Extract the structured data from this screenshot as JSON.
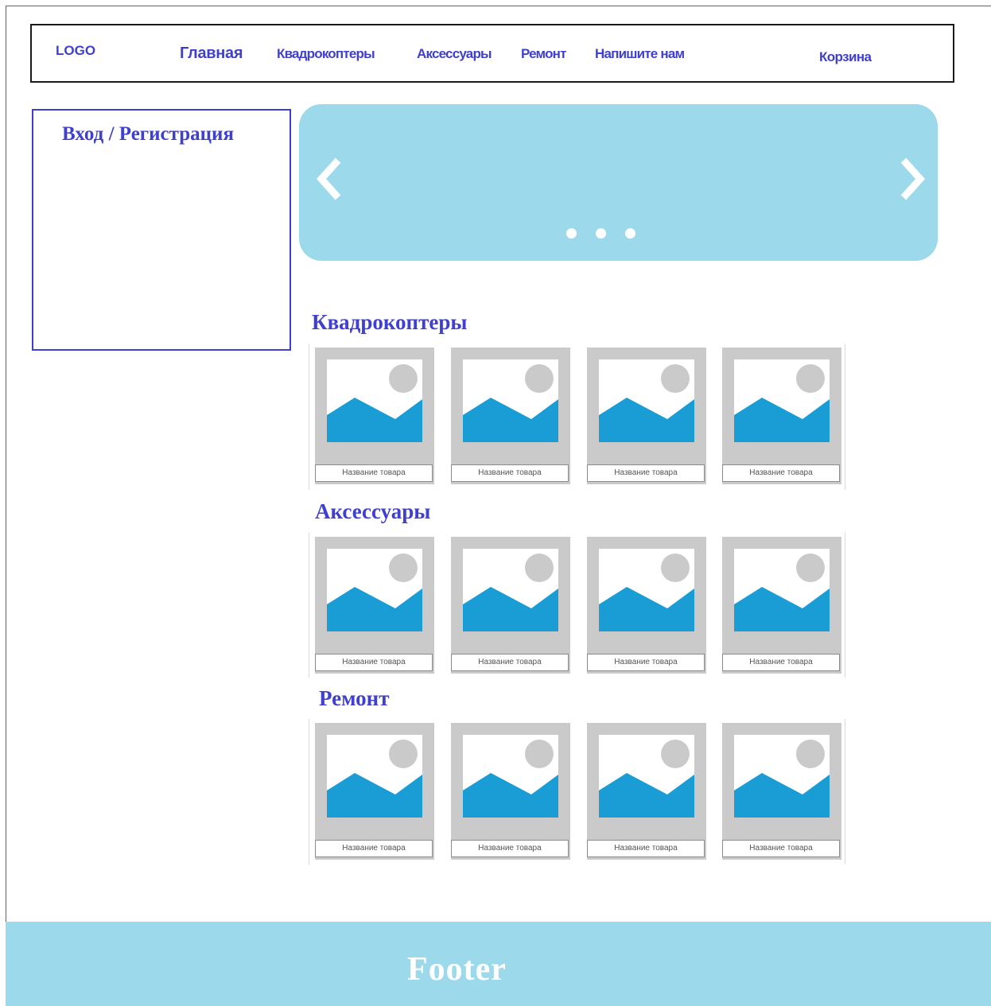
{
  "header": {
    "logo": "LOGO",
    "nav": {
      "home": "Главная",
      "quadcopters": "Квадрокоптеры",
      "accessories": "Аксессуары",
      "repair": "Ремонт",
      "contact": "Напишите нам"
    },
    "cart": "Корзина"
  },
  "sidebar": {
    "login_title": "Вход / Регистрация"
  },
  "slider": {
    "prev_icon": "chevron-left-icon",
    "next_icon": "chevron-right-icon",
    "dots": 3
  },
  "sections": [
    {
      "title": "Квадрокоптеры",
      "products": [
        "Название товара",
        "Название товара",
        "Название товара",
        "Название товара"
      ]
    },
    {
      "title": "Аксессуары",
      "products": [
        "Название товара",
        "Название товара",
        "Название товара",
        "Название товара"
      ]
    },
    {
      "title": "Ремонт",
      "products": [
        "Название товара",
        "Название товара",
        "Название товара",
        "Название товара"
      ]
    }
  ],
  "footer": {
    "text": "Footer"
  },
  "colors": {
    "accent": "#3f3fd0",
    "slider_bg": "#9cd9ea",
    "image_blue": "#1a9cd4",
    "card_gray": "#cacaca"
  }
}
